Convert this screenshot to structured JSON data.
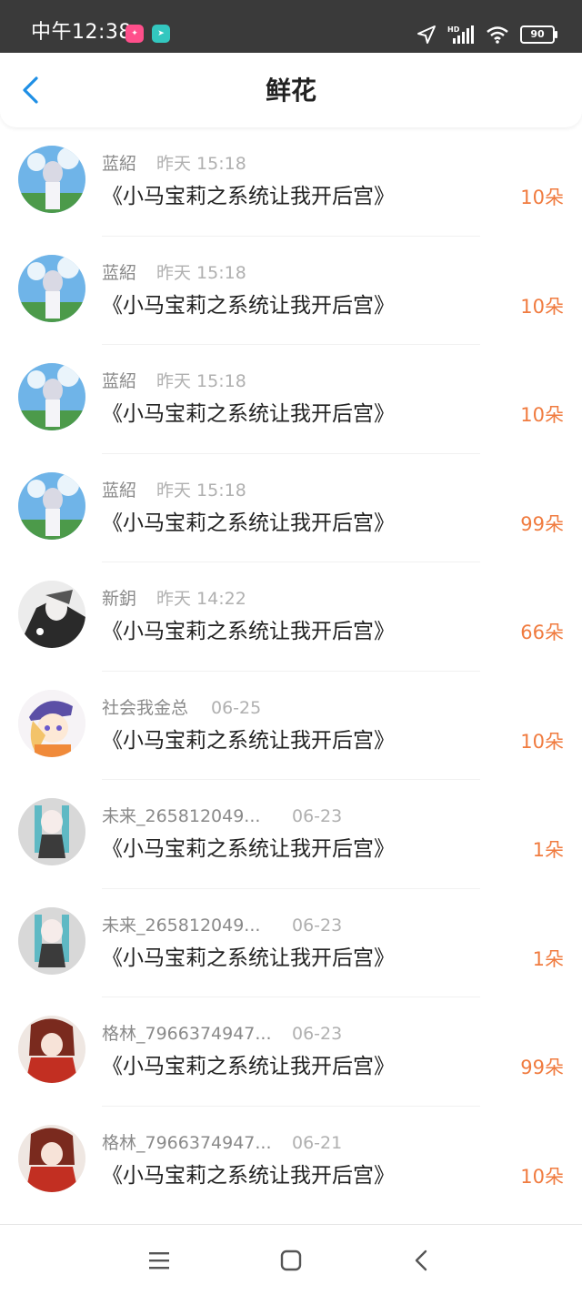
{
  "status_bar": {
    "time": "中午12:38",
    "battery": "90",
    "signal_label": "HD"
  },
  "header": {
    "title": "鲜花"
  },
  "items": [
    {
      "name": "蓝紹",
      "time": "昨天 15:18",
      "book": "《小马宝莉之系统让我开后宫》",
      "count": "10朵"
    },
    {
      "name": "蓝紹",
      "time": "昨天 15:18",
      "book": "《小马宝莉之系统让我开后宫》",
      "count": "10朵"
    },
    {
      "name": "蓝紹",
      "time": "昨天 15:18",
      "book": "《小马宝莉之系统让我开后宫》",
      "count": "10朵"
    },
    {
      "name": "蓝紹",
      "time": "昨天 15:18",
      "book": "《小马宝莉之系统让我开后宫》",
      "count": "99朵"
    },
    {
      "name": "新鈅",
      "time": "昨天 14:22",
      "book": "《小马宝莉之系统让我开后宫》",
      "count": "66朵"
    },
    {
      "name": "社会我金总",
      "time": "06-25",
      "book": "《小马宝莉之系统让我开后宫》",
      "count": "10朵"
    },
    {
      "name": "未来_265812049...",
      "time": "06-23",
      "book": "《小马宝莉之系统让我开后宫》",
      "count": "1朵"
    },
    {
      "name": "未来_265812049...",
      "time": "06-23",
      "book": "《小马宝莉之系统让我开后宫》",
      "count": "1朵"
    },
    {
      "name": "格林_7966374947...",
      "time": "06-23",
      "book": "《小马宝莉之系统让我开后宫》",
      "count": "99朵"
    },
    {
      "name": "格林_7966374947...",
      "time": "06-21",
      "book": "《小马宝莉之系统让我开后宫》",
      "count": "10朵"
    }
  ],
  "colors": {
    "accent": "#1f8fe5",
    "count": "#f07b3f"
  },
  "icons": {
    "back": "chevron-left-icon",
    "nav_menu": "menu-icon",
    "nav_home": "square-icon",
    "nav_back": "back-icon"
  }
}
